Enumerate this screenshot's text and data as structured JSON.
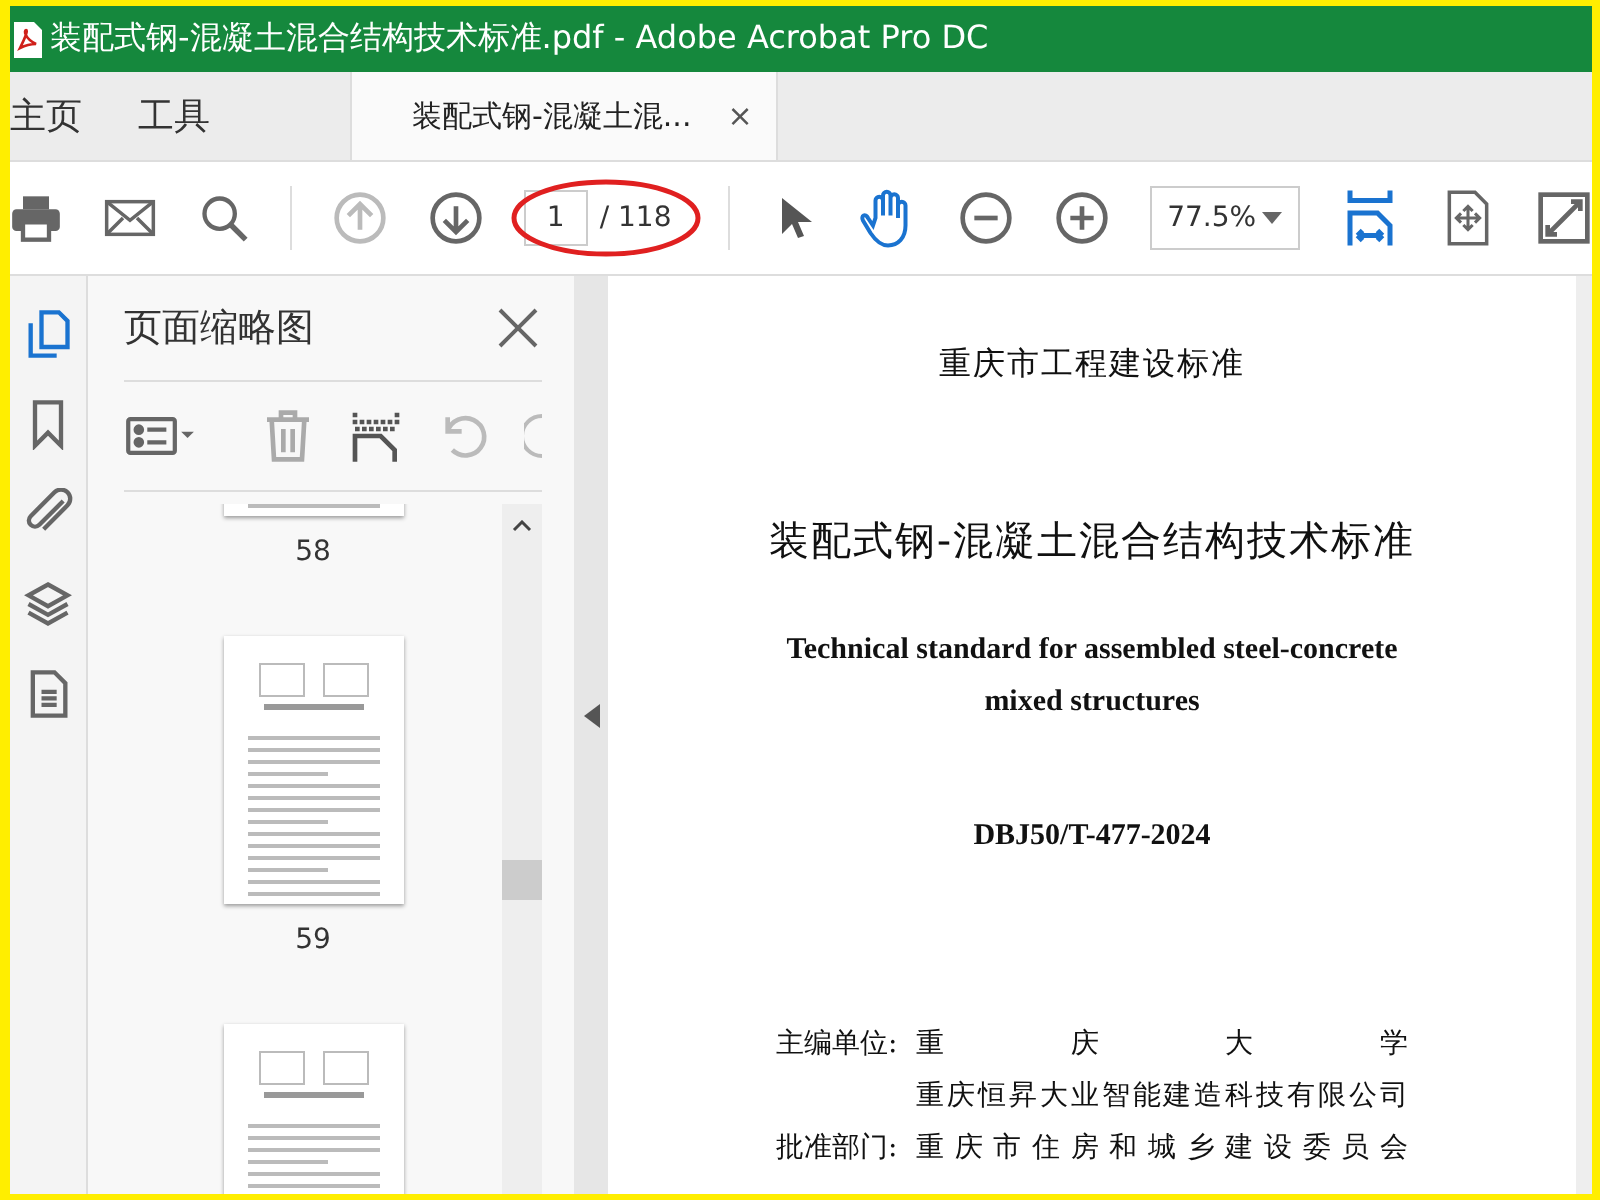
{
  "window": {
    "title": "装配式钢-混凝土混合结构技术标准.pdf - Adobe Acrobat Pro DC"
  },
  "nav_tabs": [
    {
      "label": "主页",
      "selected": false
    },
    {
      "label": "工具",
      "selected": false
    },
    {
      "label": "装配式钢-混凝土混...",
      "selected": true,
      "close": "×"
    }
  ],
  "toolbar": {
    "page_number": "1",
    "page_total": "/ 118",
    "zoom": "77.5%"
  },
  "panel": {
    "title": "页面缩略图",
    "thumbnails": [
      {
        "label": "58"
      },
      {
        "label": "59"
      }
    ]
  },
  "document": {
    "header": "重庆市工程建设标准",
    "title": "装配式钢-混凝土混合结构技术标准",
    "english_title": "Technical standard for assembled steel-concrete mixed structures",
    "code": "DBJ50/T-477-2024",
    "credits": [
      {
        "label": "主编单位:",
        "value": "重 庆 大 学"
      },
      {
        "value": "重庆恒昇大业智能建造科技有限公司"
      },
      {
        "label": "批准部门:",
        "value": "重 庆 市 住 房 和 城 乡 建 设 委 员 会"
      }
    ]
  }
}
